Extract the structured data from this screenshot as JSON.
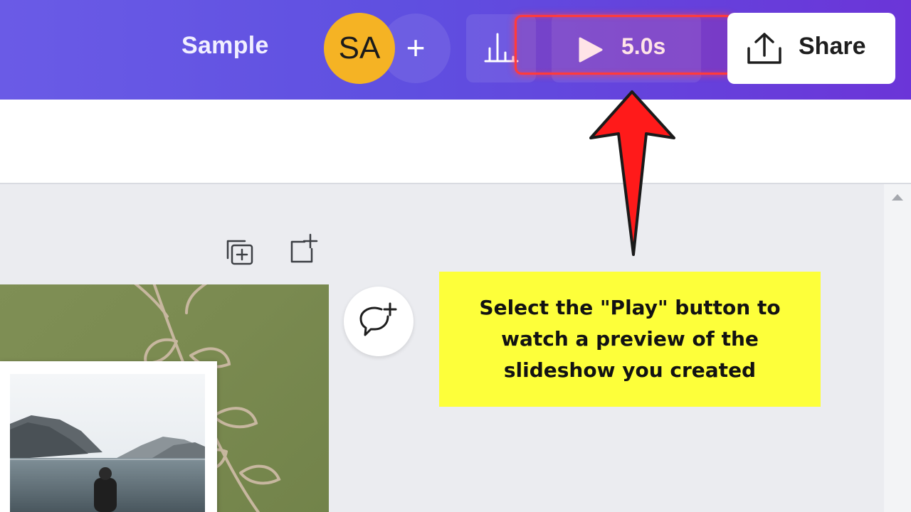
{
  "header": {
    "title": "Sample",
    "avatar_initials": "SA",
    "add_label": "+",
    "play_duration": "5.0s",
    "share_label": "Share"
  },
  "icons": {
    "add": "plus-icon",
    "analytics": "bar-chart-icon",
    "play": "play-icon",
    "share": "upload-icon",
    "duplicate_page": "duplicate-page-icon",
    "add_page": "add-page-icon",
    "comment": "add-comment-icon"
  },
  "callout": {
    "text": "Select the \"Play\" button to watch a preview of the slideshow you created"
  },
  "colors": {
    "header_gradient_start": "#6a5be6",
    "header_gradient_end": "#6b35d8",
    "avatar": "#f5b324",
    "highlight": "#ff3b3b",
    "arrow": "#ff1a1a",
    "callout": "#fdff3a",
    "slide_green": "#7a8a50"
  }
}
